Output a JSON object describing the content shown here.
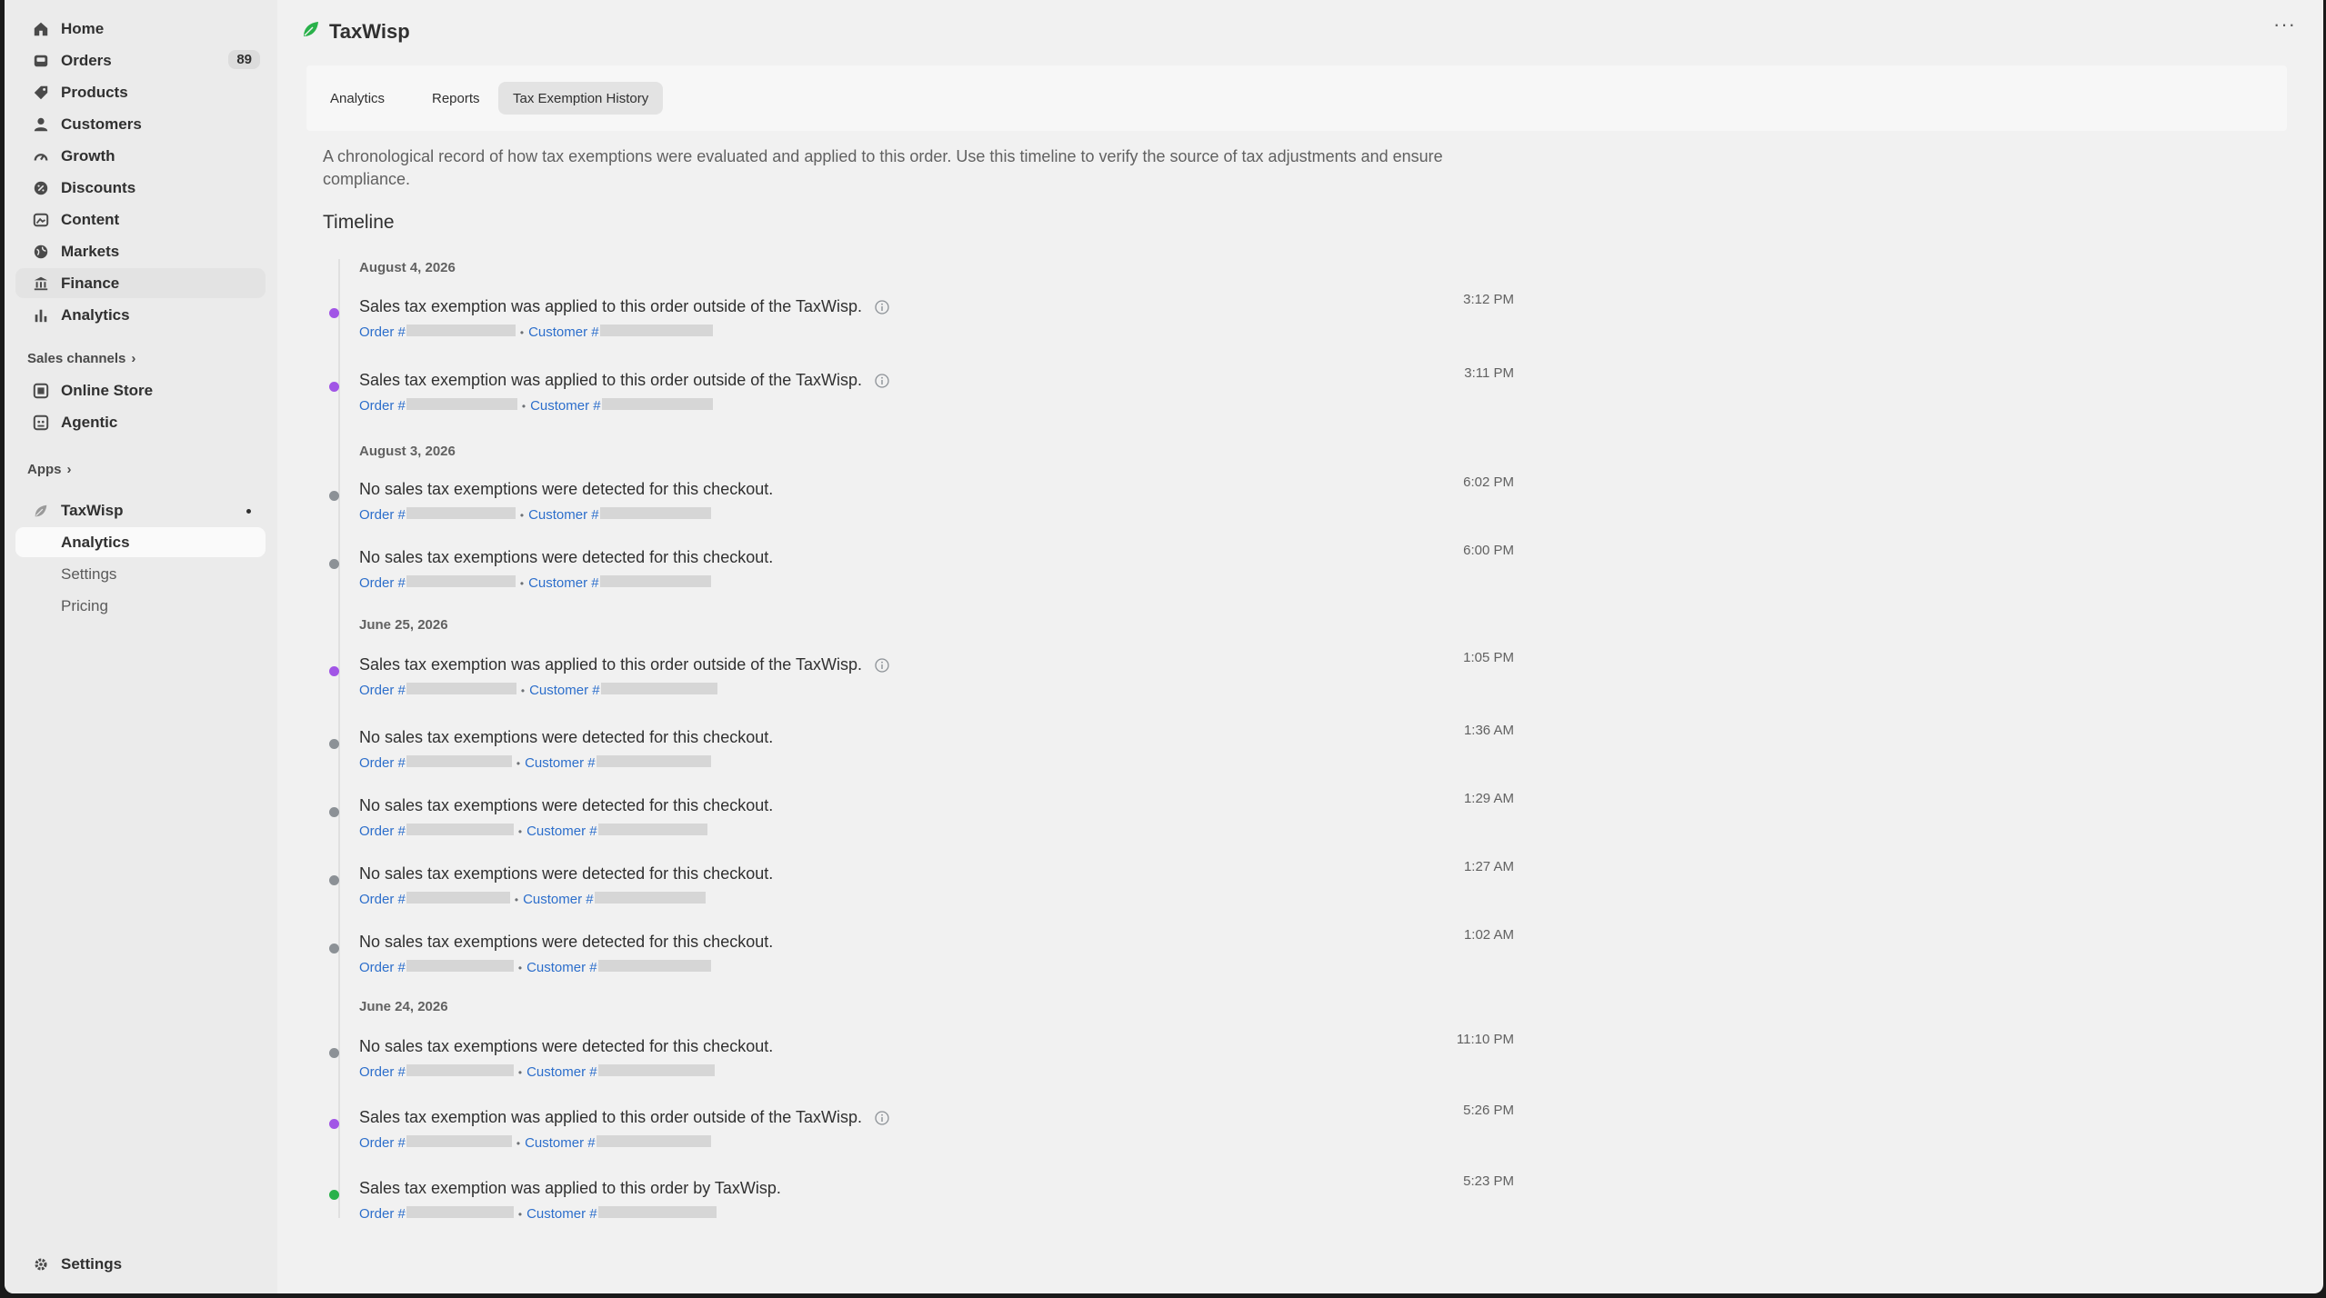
{
  "sidebar": {
    "items": [
      {
        "label": "Home",
        "icon": "home-icon"
      },
      {
        "label": "Orders",
        "icon": "inbox-icon",
        "badge": "89"
      },
      {
        "label": "Products",
        "icon": "tag-icon"
      },
      {
        "label": "Customers",
        "icon": "person-icon"
      },
      {
        "label": "Growth",
        "icon": "gauge-icon"
      },
      {
        "label": "Discounts",
        "icon": "discount-icon"
      },
      {
        "label": "Content",
        "icon": "image-icon"
      },
      {
        "label": "Markets",
        "icon": "globe-icon"
      },
      {
        "label": "Finance",
        "icon": "bank-icon"
      },
      {
        "label": "Analytics",
        "icon": "bar-chart-icon"
      }
    ],
    "sales_channels_label": "Sales channels",
    "channels": [
      {
        "label": "Online Store",
        "icon": "store-icon"
      },
      {
        "label": "Agentic",
        "icon": "agent-icon"
      }
    ],
    "apps_label": "Apps",
    "app": {
      "label": "TaxWisp",
      "icon": "taxwisp-leaf-icon"
    },
    "app_subitems": [
      "Analytics",
      "Settings",
      "Pricing"
    ],
    "settings_label": "Settings"
  },
  "header": {
    "app_title": "TaxWisp",
    "more": "···"
  },
  "tabs": [
    "Analytics",
    "Reports",
    "Tax Exemption History"
  ],
  "intro_text": "A chronological record of how tax exemptions were evaluated and applied to this order. Use this timeline to verify the source of tax adjustments and ensure compliance.",
  "timeline_title": "Timeline",
  "order_label": "Order #",
  "customer_label": "Customer #",
  "groups": [
    {
      "date": "August 4, 2026",
      "events": [
        {
          "message": "Sales tax exemption was applied to this order outside of the TaxWisp.",
          "time": "3:12 PM",
          "status": "purple",
          "info": true
        },
        {
          "message": "Sales tax exemption was applied to this order outside of the TaxWisp.",
          "time": "3:11 PM",
          "status": "purple",
          "info": true
        }
      ]
    },
    {
      "date": "August 3, 2026",
      "events": [
        {
          "message": "No sales tax exemptions were detected for this checkout.",
          "time": "6:02 PM",
          "status": "gray",
          "info": false
        },
        {
          "message": "No sales tax exemptions were detected for this checkout.",
          "time": "6:00 PM",
          "status": "gray",
          "info": false
        }
      ]
    },
    {
      "date": "June 25, 2026",
      "events": [
        {
          "message": "Sales tax exemption was applied to this order outside of the TaxWisp.",
          "time": "1:05 PM",
          "status": "purple",
          "info": true
        },
        {
          "message": "No sales tax exemptions were detected for this checkout.",
          "time": "1:36 AM",
          "status": "gray",
          "info": false
        },
        {
          "message": "No sales tax exemptions were detected for this checkout.",
          "time": "1:29 AM",
          "status": "gray",
          "info": false
        },
        {
          "message": "No sales tax exemptions were detected for this checkout.",
          "time": "1:27 AM",
          "status": "gray",
          "info": false
        },
        {
          "message": "No sales tax exemptions were detected for this checkout.",
          "time": "1:02 AM",
          "status": "gray",
          "info": false
        }
      ]
    },
    {
      "date": "June 24, 2026",
      "events": [
        {
          "message": "No sales tax exemptions were detected for this checkout.",
          "time": "11:10 PM",
          "status": "gray",
          "info": false
        },
        {
          "message": "Sales tax exemption was applied to this order outside of the TaxWisp.",
          "time": "5:26 PM",
          "status": "purple",
          "info": true
        },
        {
          "message": "Sales tax exemption was applied to this order by TaxWisp.",
          "time": "5:23 PM",
          "status": "green",
          "info": false
        }
      ]
    }
  ],
  "colors": {
    "applied_outside": "#a155e6",
    "not_detected": "#8c9196",
    "applied_by_app": "#29b14a",
    "link": "#2c6ecb"
  }
}
